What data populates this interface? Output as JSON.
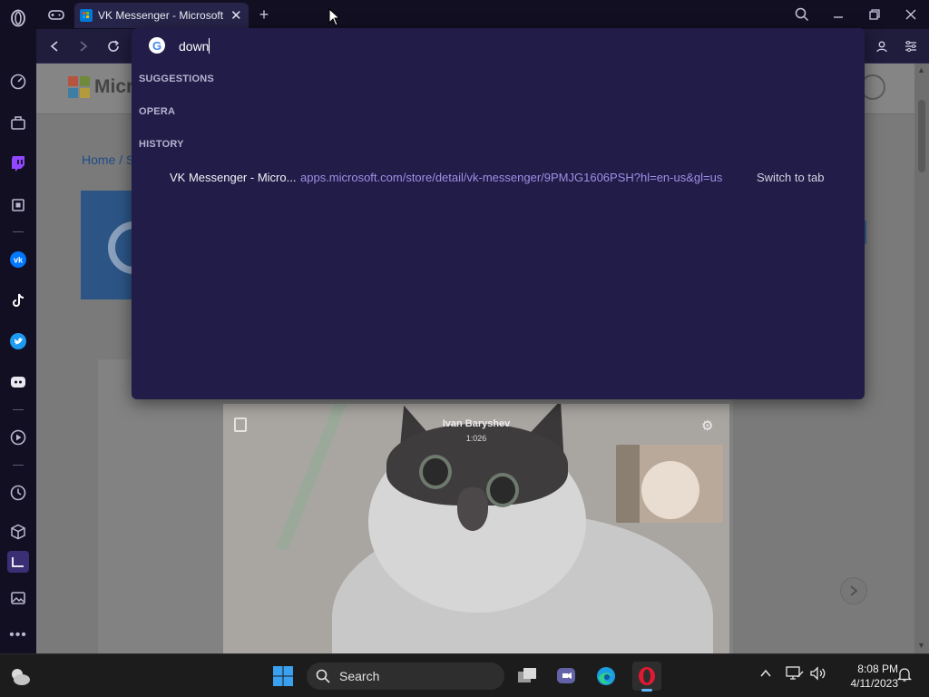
{
  "browser": {
    "tab": {
      "title": "VK Messenger - Microsoft Store"
    }
  },
  "omnibox": {
    "query": "down",
    "sections": {
      "suggestions": "SUGGESTIONS",
      "opera": "OPERA",
      "history": "HISTORY"
    },
    "history_items": [
      {
        "title": "VK Messenger - Micro...",
        "url": "apps.microsoft.com/store/detail/vk-messenger/9PMJG1606PSH?hl=en-us&gl=us",
        "action": "Switch to tab"
      }
    ]
  },
  "page": {
    "logo_text": "Micro",
    "breadcrumb": "Home / S"
  },
  "video_call": {
    "caller_name": "Ivan Baryshev",
    "duration": "1:026"
  },
  "taskbar": {
    "search_label": "Search",
    "time": "8:08 PM",
    "date": "4/11/2023"
  },
  "colors": {
    "sidebar_bg": "#120f22",
    "dropdown_bg": "#221c48",
    "url_text": "#9f8fe6",
    "taskbar_bg": "#1c1c1c",
    "vk_blue": "#2c5586"
  }
}
